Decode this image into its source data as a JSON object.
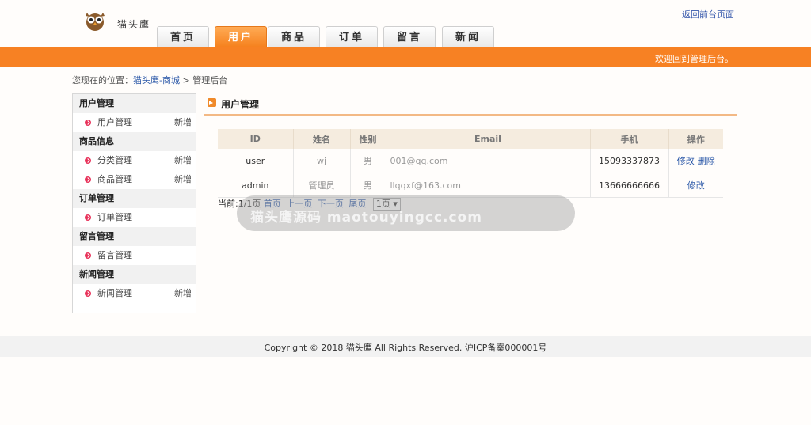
{
  "header": {
    "logo_text": "猫头鹰",
    "top_link": "返回前台页面",
    "welcome": "欢迎回到管理后台。"
  },
  "nav": {
    "tabs": [
      {
        "label": "首页",
        "active": false
      },
      {
        "label": "用户",
        "active": true
      },
      {
        "label": "商品",
        "active": false
      },
      {
        "label": "订单",
        "active": false
      },
      {
        "label": "留言",
        "active": false
      },
      {
        "label": "新闻",
        "active": false
      }
    ]
  },
  "breadcrumb": {
    "prefix": "您现在的位置：",
    "link": "猫头鹰-商城",
    "separator": ">",
    "current": "管理后台"
  },
  "sidebar": {
    "groups": [
      {
        "title": "用户管理",
        "items": [
          {
            "label": "用户管理",
            "add": "新增"
          }
        ]
      },
      {
        "title": "商品信息",
        "items": [
          {
            "label": "分类管理",
            "add": "新增"
          },
          {
            "label": "商品管理",
            "add": "新增"
          }
        ]
      },
      {
        "title": "订单管理",
        "items": [
          {
            "label": "订单管理",
            "add": ""
          }
        ]
      },
      {
        "title": "留言管理",
        "items": [
          {
            "label": "留言管理",
            "add": ""
          }
        ]
      },
      {
        "title": "新闻管理",
        "items": [
          {
            "label": "新闻管理",
            "add": "新增"
          }
        ]
      }
    ]
  },
  "main": {
    "title": "用户管理",
    "columns": [
      "ID",
      "姓名",
      "性别",
      "Email",
      "手机",
      "操作"
    ],
    "rows": [
      {
        "id": "user",
        "name": "wj",
        "gender": "男",
        "email": "001@qq.com",
        "phone": "15093337873",
        "actions": [
          "修改",
          "删除"
        ]
      },
      {
        "id": "admin",
        "name": "管理员",
        "gender": "男",
        "email": "llqqxf@163.com",
        "phone": "13666666666",
        "actions": [
          "修改"
        ]
      }
    ],
    "pager": {
      "current": "当前:1/1页",
      "first": "首页",
      "prev": "上一页",
      "next": "下一页",
      "last": "尾页",
      "select": "1页"
    }
  },
  "watermark": "猫头鹰源码 maotouyingcc.com",
  "footer": "Copyright © 2018 猫头鹰 All Rights Reserved. 沪ICP备案000001号",
  "colors": {
    "accent": "#f78123",
    "link": "#2b58a8",
    "bullet": "#e8325a"
  }
}
